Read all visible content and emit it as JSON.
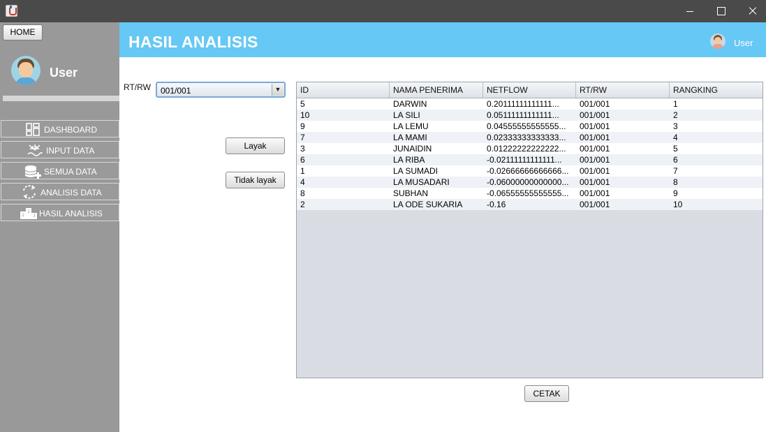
{
  "window": {
    "controls": {
      "minimize": "minimize-icon",
      "maximize": "maximize-icon",
      "close": "close-icon"
    }
  },
  "sidebar": {
    "home_label": "HOME",
    "user_name": "User",
    "items": [
      {
        "label": "DASHBOARD",
        "icon": "dashboard-icon"
      },
      {
        "label": "INPUT DATA",
        "icon": "input-data-icon"
      },
      {
        "label": "SEMUA DATA",
        "icon": "database-add-icon"
      },
      {
        "label": "ANALISIS DATA",
        "icon": "refresh-cycle-icon"
      },
      {
        "label": "HASIL ANALISIS",
        "icon": "podium-icon"
      }
    ]
  },
  "header": {
    "title": "HASIL ANALISIS",
    "user_name": "User"
  },
  "filter": {
    "label": "RT/RW",
    "selected": "001/001"
  },
  "buttons": {
    "layak": "Layak",
    "tidak_layak": "Tidak layak",
    "cetak": "CETAK"
  },
  "table": {
    "columns": [
      "ID",
      "NAMA PENERIMA",
      "NETFLOW",
      "RT/RW",
      "RANGKING"
    ],
    "rows": [
      [
        "5",
        "DARWIN",
        "0.20111111111111...",
        "001/001",
        "1"
      ],
      [
        "10",
        "LA SILI",
        "0.05111111111111...",
        "001/001",
        "2"
      ],
      [
        "9",
        "LA LEMU",
        "0.04555555555555...",
        "001/001",
        "3"
      ],
      [
        "7",
        "LA MAMI",
        "0.02333333333333...",
        "001/001",
        "4"
      ],
      [
        "3",
        "JUNAIDIN",
        "0.01222222222222...",
        "001/001",
        "5"
      ],
      [
        "6",
        "LA RIBA",
        "-0.02111111111111...",
        "001/001",
        "6"
      ],
      [
        "1",
        "LA SUMADI",
        "-0.02666666666666...",
        "001/001",
        "7"
      ],
      [
        "4",
        "LA MUSADARI",
        "-0.06000000000000...",
        "001/001",
        "8"
      ],
      [
        "8",
        "SUBHAN",
        "-0.06555555555555...",
        "001/001",
        "9"
      ],
      [
        "2",
        "LA ODE SUKARIA",
        "-0.16",
        "001/001",
        "10"
      ]
    ]
  },
  "colors": {
    "header_bg": "#66c8f4",
    "sidebar_bg": "#999999",
    "titlebar_bg": "#4a4a4a"
  }
}
